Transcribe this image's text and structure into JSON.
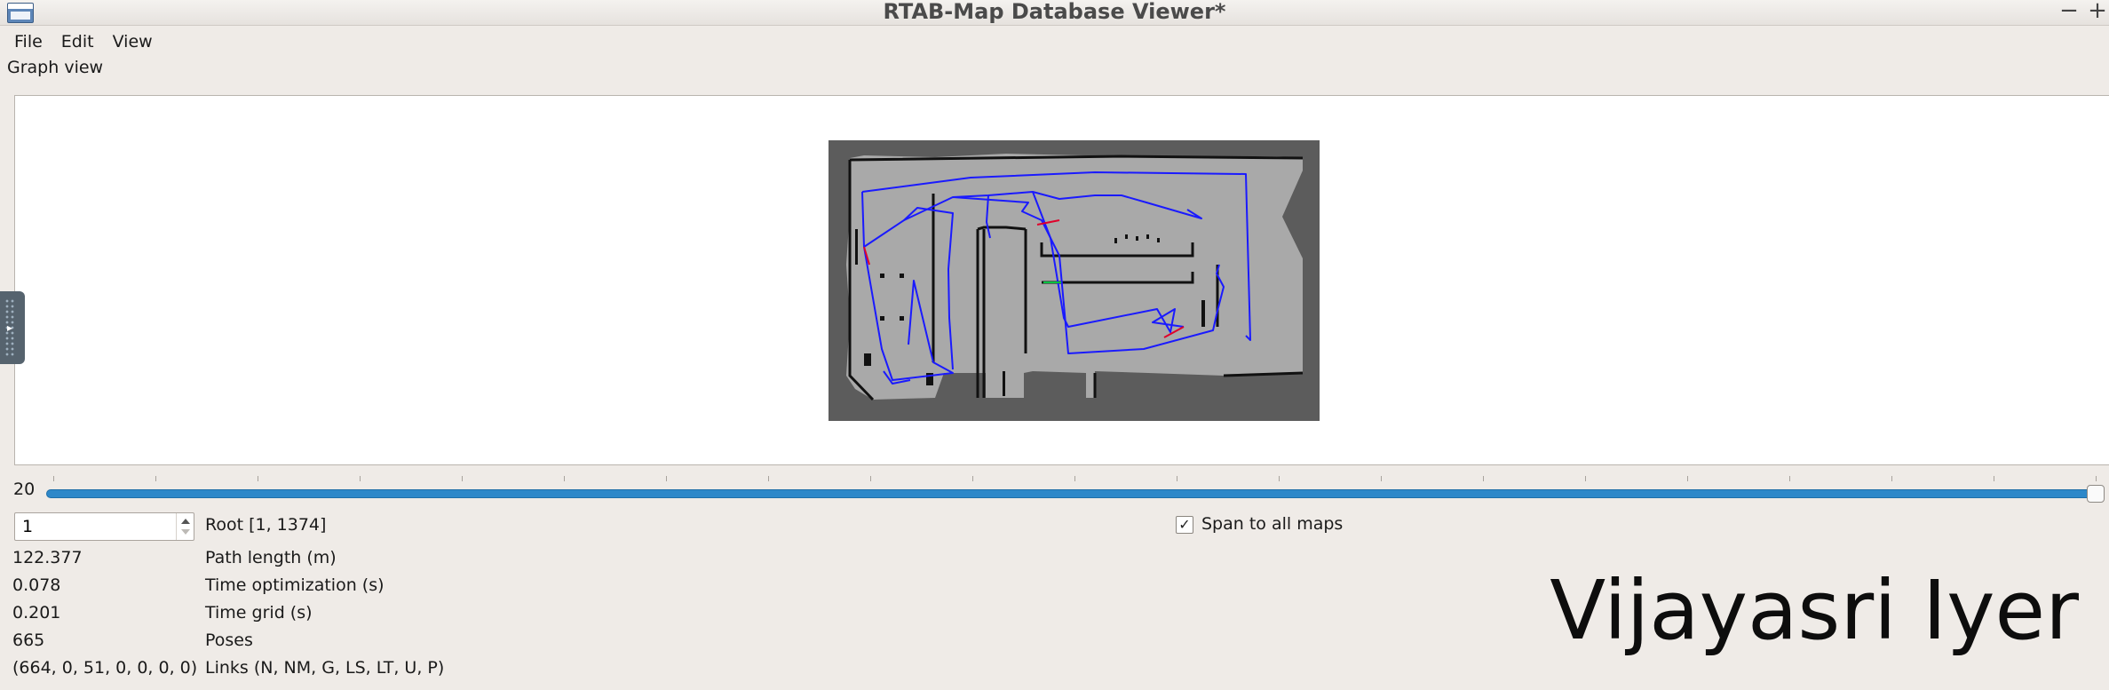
{
  "window": {
    "title": "RTAB-Map Database Viewer*",
    "minimize_symbol": "−",
    "maximize_symbol": "+"
  },
  "menu": [
    {
      "label": "File"
    },
    {
      "label": "Edit"
    },
    {
      "label": "View"
    }
  ],
  "graph_view": {
    "title": "Graph view"
  },
  "slider": {
    "value_label": "20"
  },
  "root": {
    "input_value": "1",
    "label": "Root [1, 1374]"
  },
  "span": {
    "checked_symbol": "✓",
    "label": "Span to all maps",
    "checked": true
  },
  "stats": [
    {
      "value": "122.377",
      "label": "Path length (m)"
    },
    {
      "value": "0.078",
      "label": "Time optimization (s)"
    },
    {
      "value": "0.201",
      "label": "Time grid (s)"
    },
    {
      "value": "665",
      "label": "Poses"
    },
    {
      "value": "(664, 0, 51, 0, 0, 0, 0)",
      "label": "Links (N, NM, G, LS, LT, U, P)"
    }
  ],
  "watermark": "Vijayasri Iyer",
  "colors": {
    "path_blue": "#1a1aff",
    "link_red": "#e0002a",
    "link_green": "#00c040",
    "map_unknown": "#5c5c5c",
    "map_free": "#a9a9a9",
    "slider_accent": "#2e88c9"
  }
}
